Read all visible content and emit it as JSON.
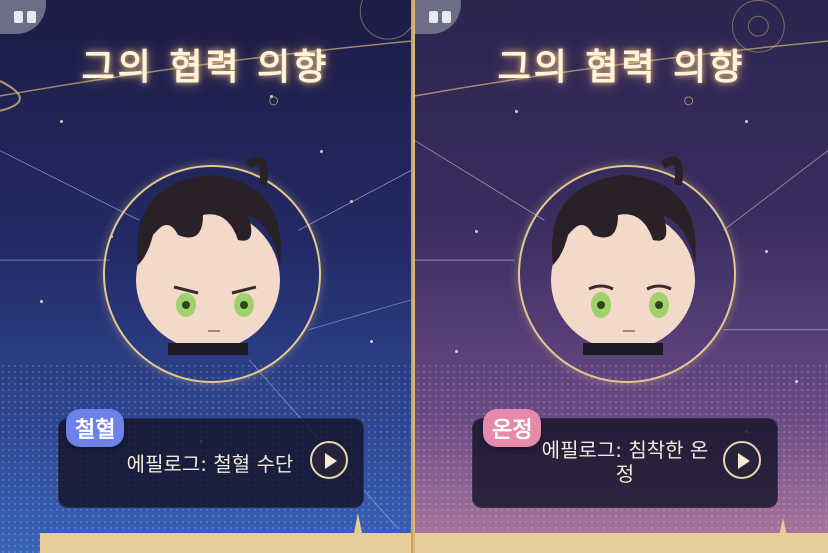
{
  "cards": [
    {
      "title": "그의 협력 의향",
      "tag": "철혈",
      "tag_color": "#6c82e8",
      "voice_line": "에필로그: 철혈 수단",
      "pause_icon": "pause-icon",
      "play_icon": "play-icon"
    },
    {
      "title": "그의 협력 의향",
      "tag": "온정",
      "tag_color": "#e58aaa",
      "voice_line_1": "에필로그: 침착한 온",
      "voice_line_2": "정",
      "pause_icon": "pause-icon",
      "play_icon": "play-icon"
    }
  ],
  "colors": {
    "accent_gold": "#e3c88c",
    "left_bg": "#232a66",
    "right_bg": "#3a2d60"
  }
}
